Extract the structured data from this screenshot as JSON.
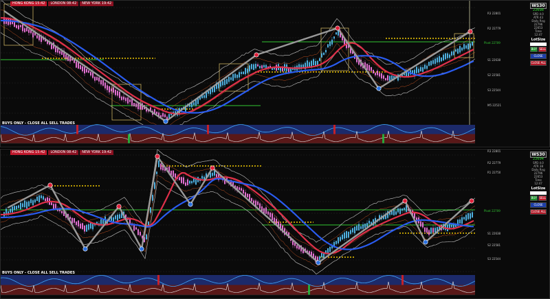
{
  "panes": [
    {
      "sessions": [
        "HONG KONG 15:42",
        "LONDON 08:42",
        "NEW YORK 19:42"
      ],
      "symbol": "WS30",
      "price": "22698",
      "stats": [
        "SPD 4.0",
        "ATR 43",
        "Daily Rng",
        "22796",
        "22653",
        "Time",
        "12:47"
      ],
      "lot_title": "LotSize",
      "lot_value": "",
      "buy_label": "BUY",
      "sell_label": "SELL",
      "close_label": "CLOSE",
      "close_all_label": "CLOSE ALL",
      "indicator_label": "BUYS ONLY - CLOSE ALL SELL TRADES",
      "pivot_label": "Pivot 22709",
      "levels": [
        "R3 22801",
        "R2 22779",
        "R1 22750",
        "S1 22638",
        "S2 22581",
        "S3 22544",
        "M5 22521",
        "M4 22480"
      ]
    },
    {
      "sessions": [
        "HONG KONG 15:42",
        "LONDON 08:42",
        "NEW YORK 19:42"
      ],
      "symbol": "WS30",
      "price": "22694",
      "stats": [
        "SPD 4.0",
        "ATR 38",
        "Daily Rng",
        "22796",
        "22653",
        "Time",
        "12:47"
      ],
      "lot_title": "LotSize",
      "lot_value": "",
      "buy_label": "BUY",
      "sell_label": "SELL",
      "close_label": "CLOSE",
      "close_all_label": "CLOSE ALL",
      "indicator_label": "BUYS ONLY - CLOSE ALL SELL TRADES",
      "pivot_label": "Pivot 22709",
      "levels": [
        "R3 22801",
        "R2 22779",
        "R1 22750",
        "S1 22638",
        "S2 22581",
        "S3 22544",
        "M5 22521",
        "M4 22480"
      ]
    }
  ],
  "colors": {
    "up_candle": "#4fb0e0",
    "down_candle": "#e070d0",
    "ma_fast": "#e0304a",
    "ma_slow": "#2a5cf0",
    "envelope": "#c8c8c8",
    "pivot_line": "#32c832",
    "dotted_level": "#f0c800",
    "zigzag": "#9a9a9a",
    "osc_top_bg": "#1c2a6a",
    "osc_bottom_bg": "#5a1818"
  }
}
